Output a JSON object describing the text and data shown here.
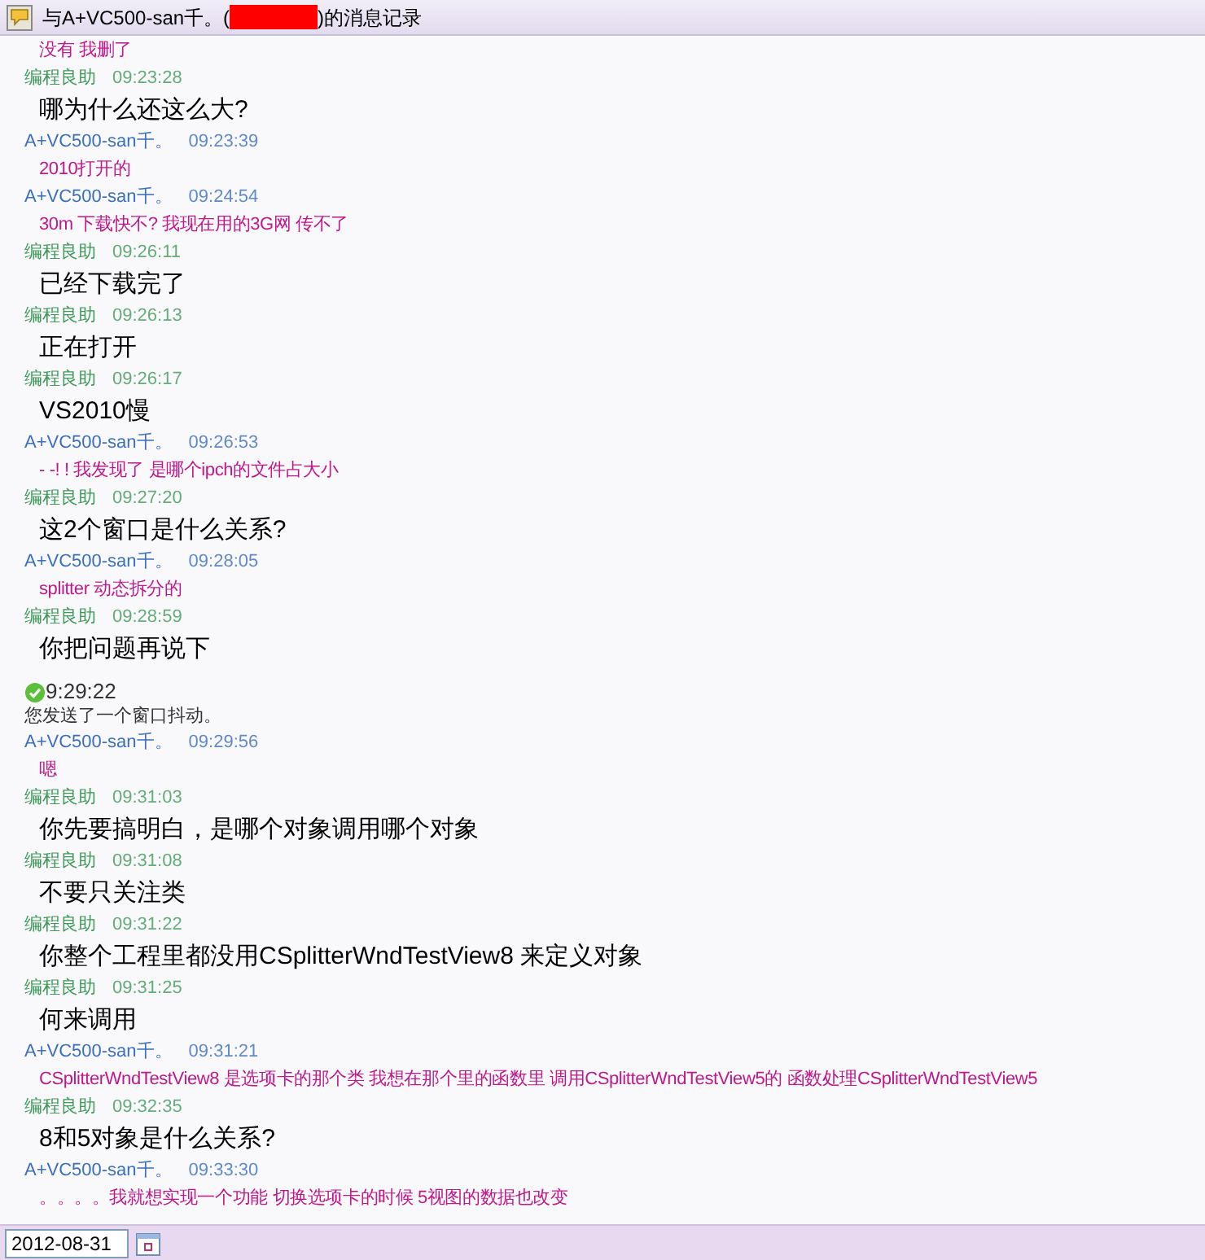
{
  "window": {
    "title_prefix": "与A+VC500-san千。(",
    "title_redacted": true,
    "title_suffix": ")的消息记录"
  },
  "messages": [
    {
      "kind": "other_text",
      "text": "没有 我删了"
    },
    {
      "kind": "self_message",
      "sender": "编程良助",
      "time": "09:23:28",
      "text": "哪为什么还这么大?"
    },
    {
      "kind": "other_message",
      "sender": "A+VC500-san千。",
      "time": "09:23:39",
      "text": "2010打开的"
    },
    {
      "kind": "other_message",
      "sender": "A+VC500-san千。",
      "time": "09:24:54",
      "text": "30m 下载快不? 我现在用的3G网 传不了"
    },
    {
      "kind": "self_message",
      "sender": "编程良助",
      "time": "09:26:11",
      "text": "已经下载完了"
    },
    {
      "kind": "self_message",
      "sender": "编程良助",
      "time": "09:26:13",
      "text": "正在打开"
    },
    {
      "kind": "self_message",
      "sender": "编程良助",
      "time": "09:26:17",
      "text": "VS2010慢"
    },
    {
      "kind": "other_message",
      "sender": "A+VC500-san千。",
      "time": "09:26:53",
      "text": "- -! ! 我发现了 是哪个ipch的文件占大小"
    },
    {
      "kind": "self_message",
      "sender": "编程良助",
      "time": "09:27:20",
      "text": "这2个窗口是什么关系?"
    },
    {
      "kind": "other_message",
      "sender": "A+VC500-san千。",
      "time": "09:28:05",
      "text": "splitter 动态拆分的"
    },
    {
      "kind": "self_message",
      "sender": "编程良助",
      "time": "09:28:59",
      "text": "你把问题再说下"
    },
    {
      "kind": "system",
      "time": "9:29:22",
      "text": "您发送了一个窗口抖动。"
    },
    {
      "kind": "other_message",
      "sender": "A+VC500-san千。",
      "time": "09:29:56",
      "text": "嗯"
    },
    {
      "kind": "self_message",
      "sender": "编程良助",
      "time": "09:31:03",
      "text": "你先要搞明白，是哪个对象调用哪个对象"
    },
    {
      "kind": "self_message",
      "sender": "编程良助",
      "time": "09:31:08",
      "text": "不要只关注类"
    },
    {
      "kind": "self_message",
      "sender": "编程良助",
      "time": "09:31:22",
      "text": "你整个工程里都没用CSplitterWndTestView8 来定义对象"
    },
    {
      "kind": "self_message",
      "sender": "编程良助",
      "time": "09:31:25",
      "text": "何来调用"
    },
    {
      "kind": "other_message",
      "sender": "A+VC500-san千。",
      "time": "09:31:21",
      "text": "CSplitterWndTestView8 是选项卡的那个类  我想在那个里的函数里 调用CSplitterWndTestView5的 函数处理CSplitterWndTestView5"
    },
    {
      "kind": "self_message",
      "sender": "编程良助",
      "time": "09:32:35",
      "text": "8和5对象是什么关系?"
    },
    {
      "kind": "other_message",
      "sender": "A+VC500-san千。",
      "time": "09:33:30",
      "text": "。。。。我就想实现一个功能 切换选项卡的时候 5视图的数据也改变"
    }
  ],
  "date_field": {
    "value": "2012-08-31"
  }
}
